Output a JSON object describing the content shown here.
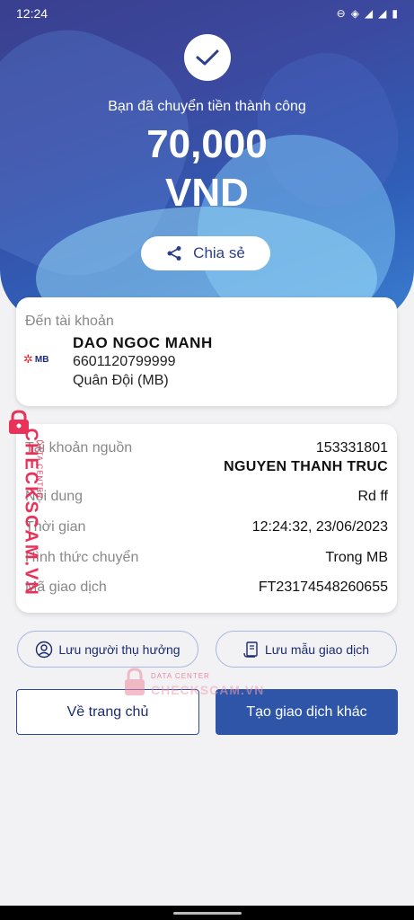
{
  "status_bar": {
    "time": "12:24"
  },
  "header": {
    "success_message": "Bạn đã chuyển tiền thành công",
    "amount": "70,000",
    "currency": "VND",
    "share_label": "Chia sẻ"
  },
  "recipient": {
    "label": "Đến tài khoản",
    "bank_logo_text": "MB",
    "name": "DAO NGOC MANH",
    "account_number": "6601120799999",
    "bank_name": "Quân Đội (MB)"
  },
  "details": {
    "source_account_label": "Tài khoản nguồn",
    "source_account_number": "153331801",
    "source_account_name": "NGUYEN THANH TRUC",
    "content_label": "Nội dung",
    "content_value": "Rd ff",
    "time_label": "Thời gian",
    "time_value": "12:24:32, 23/06/2023",
    "method_label": "Hình thức chuyển",
    "method_value": "Trong MB",
    "txn_id_label": "Mã giao dịch",
    "txn_id_value": "FT23174548260655"
  },
  "actions": {
    "save_recipient": "Lưu người thụ hưởng",
    "save_template": "Lưu mẫu giao dịch",
    "home": "Về trang chủ",
    "new_transaction": "Tạo giao dịch khác"
  },
  "watermark": {
    "brand": "CHECKSCAM.VN",
    "tagline": "DATA CENTER"
  },
  "colors": {
    "primary": "#2e55a8",
    "watermark": "#e8325a"
  }
}
